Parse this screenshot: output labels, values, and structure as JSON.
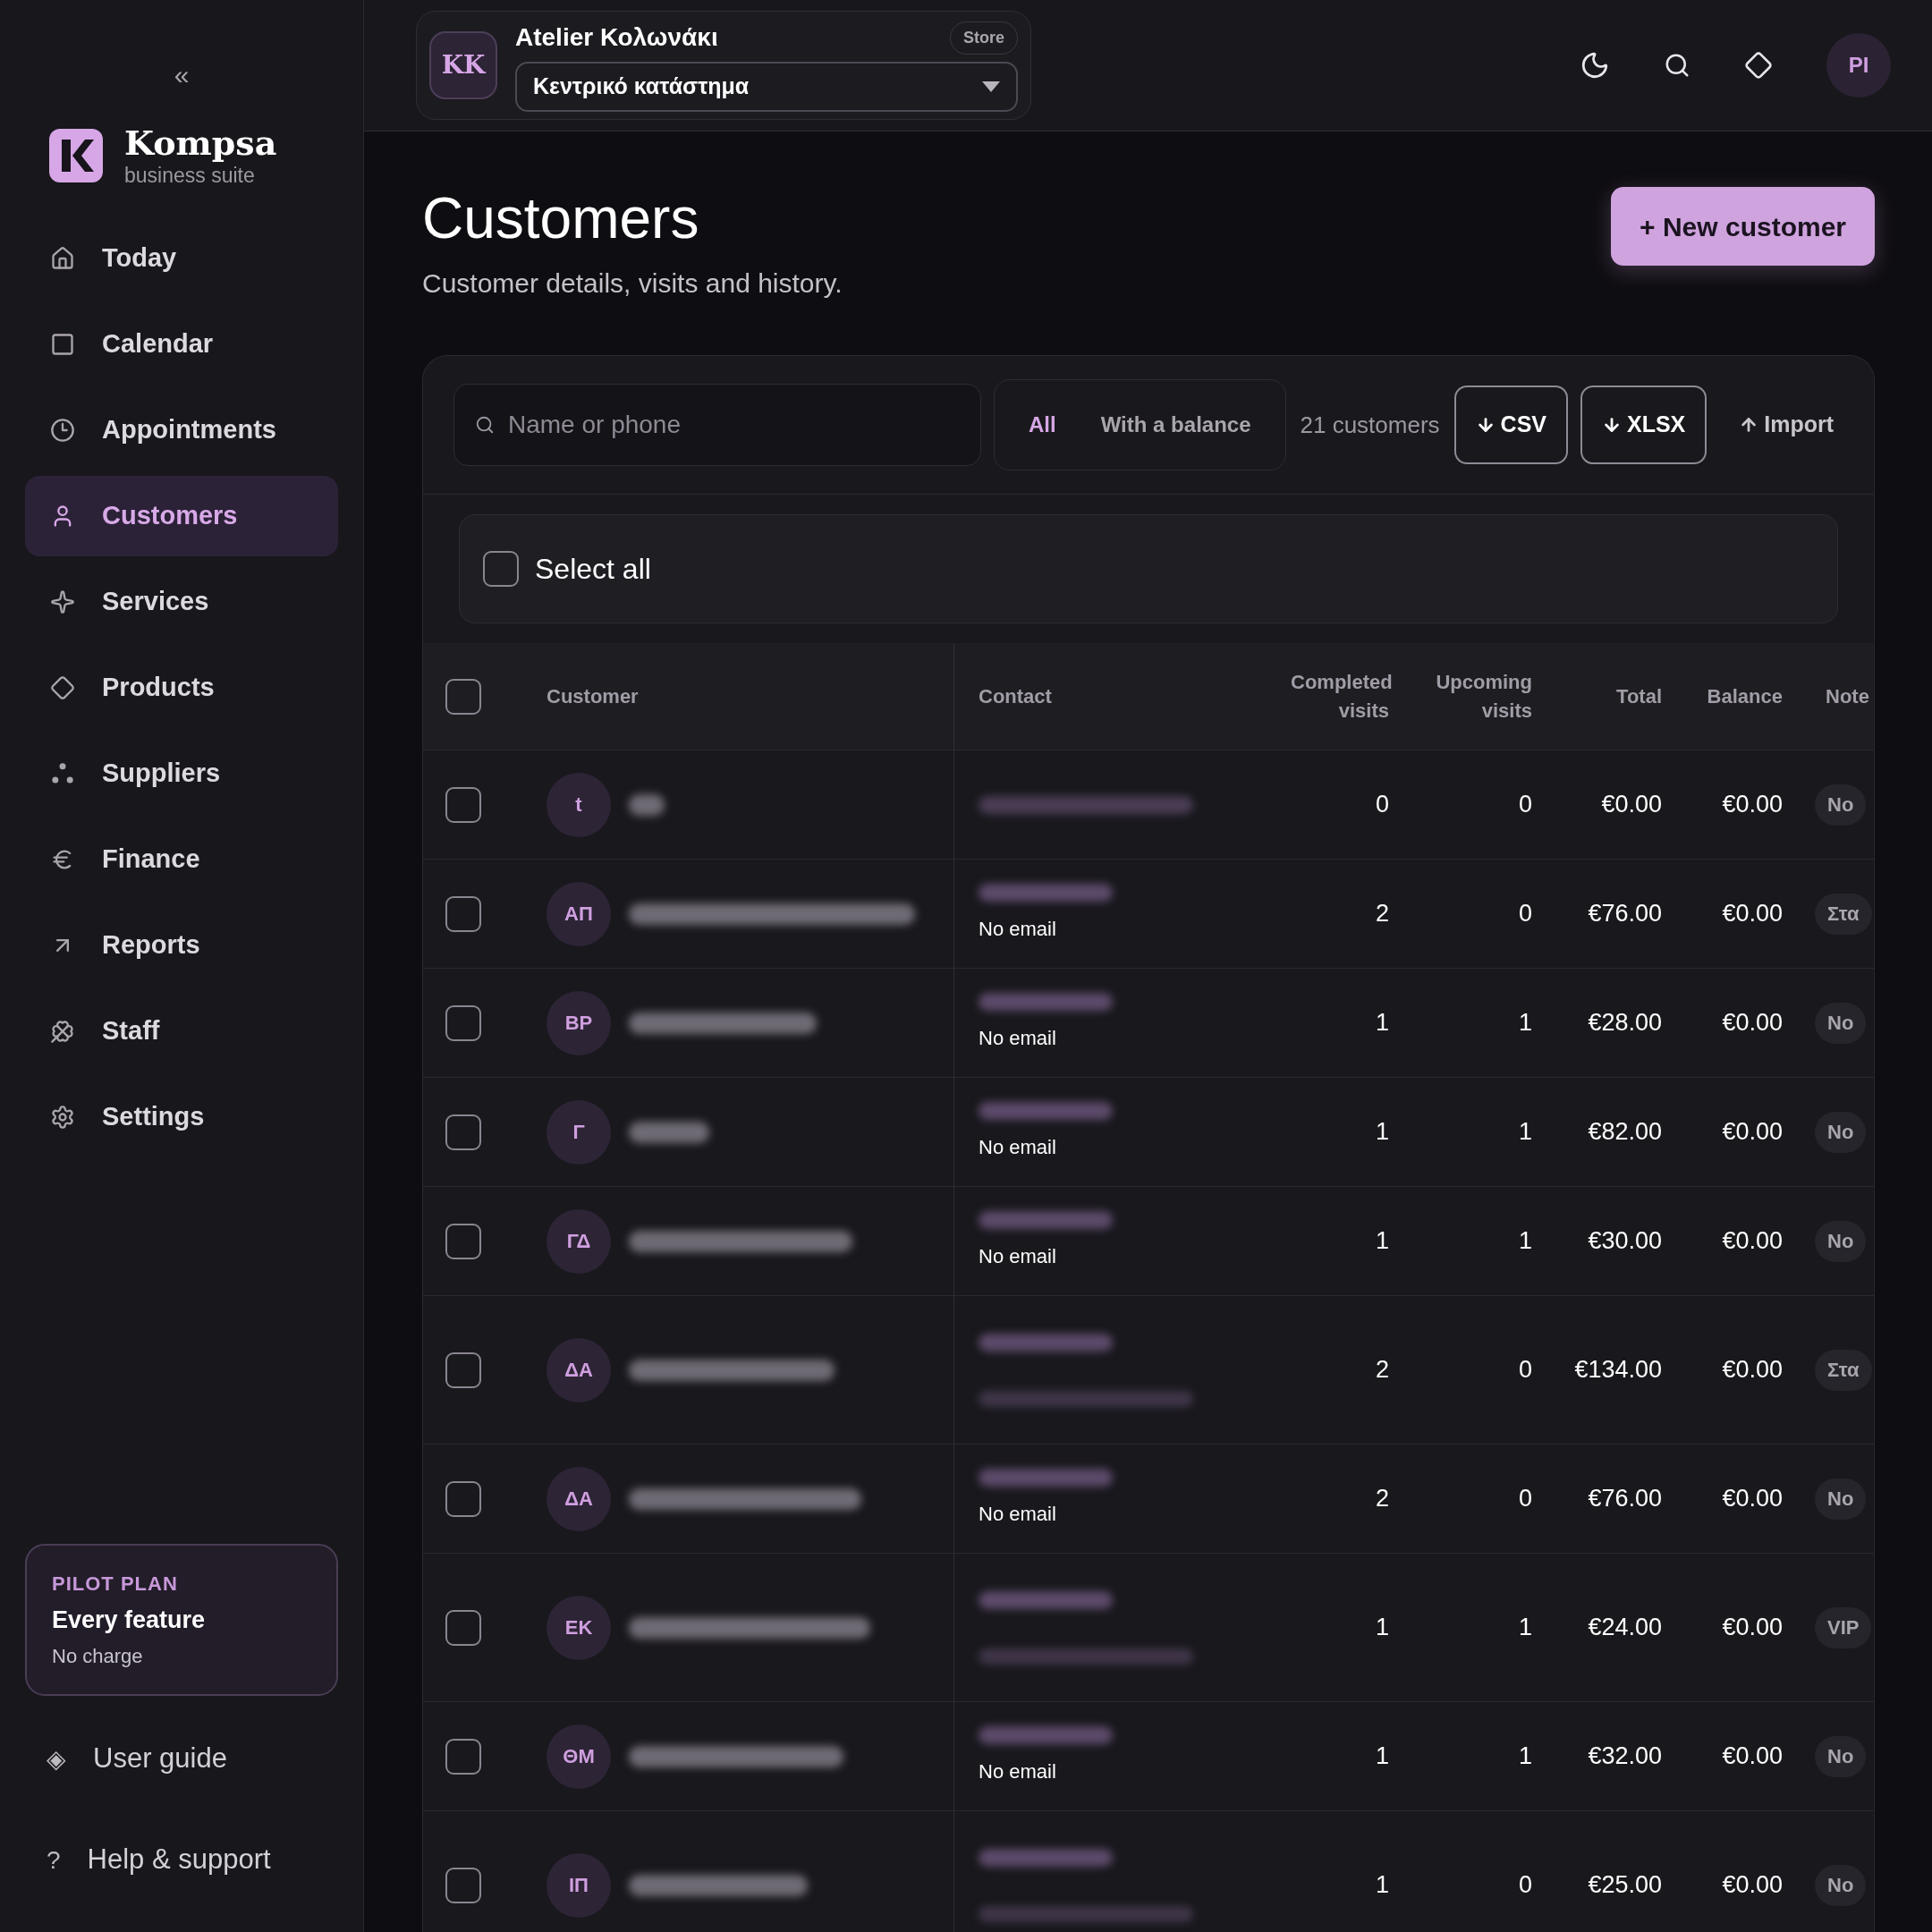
{
  "sidebar": {
    "collapse": "«",
    "brand": {
      "name": "Kompsa",
      "tagline": "business suite"
    },
    "items": [
      {
        "label": "Today",
        "selected": false
      },
      {
        "label": "Calendar",
        "selected": false
      },
      {
        "label": "Appointments",
        "selected": false
      },
      {
        "label": "Customers",
        "selected": true
      },
      {
        "label": "Services",
        "selected": false
      },
      {
        "label": "Products",
        "selected": false
      },
      {
        "label": "Suppliers",
        "selected": false
      },
      {
        "label": "Finance",
        "selected": false
      },
      {
        "label": "Reports",
        "selected": false
      },
      {
        "label": "Staff",
        "selected": false
      },
      {
        "label": "Settings",
        "selected": false
      }
    ],
    "plan": {
      "eyebrow": "PILOT PLAN",
      "title": "Every feature",
      "note": "No charge"
    },
    "footer": [
      {
        "icon_char": "◈",
        "label": "User guide"
      },
      {
        "icon_char": "?",
        "label": "Help & support"
      }
    ]
  },
  "topbar": {
    "store": {
      "initials": "KK",
      "name": "Atelier Κολωνάκι",
      "badge": "Store",
      "location": "Κεντρικό κατάστημα"
    },
    "user_initials": "PI"
  },
  "page": {
    "title": "Customers",
    "subtitle": "Customer details, visits and history.",
    "new_button": "+ New customer"
  },
  "toolbar": {
    "search": {
      "placeholder": "Name or phone"
    },
    "filters": [
      {
        "label": "All",
        "selected": true
      },
      {
        "label": "With a balance",
        "selected": false
      }
    ],
    "count": "21 customers",
    "actions": [
      {
        "label": "CSV",
        "kind": "download"
      },
      {
        "label": "XLSX",
        "kind": "download"
      },
      {
        "label": "Import",
        "kind": "import"
      }
    ]
  },
  "select_all": {
    "label": "Select all",
    "checked": false
  },
  "table": {
    "header_checked": false,
    "columns": [
      "Customer",
      "Contact",
      "Completed visits",
      "Upcoming visits",
      "Total",
      "Balance",
      "Note"
    ],
    "rows": [
      {
        "checked": false,
        "initials": "t",
        "kind": "single",
        "completed": "0",
        "upcoming": "0",
        "total": "€0.00",
        "balance": "€0.00",
        "note": "No"
      },
      {
        "checked": false,
        "initials": "ΑΠ",
        "kind": "no-email",
        "email": "No email",
        "completed": "2",
        "upcoming": "0",
        "total": "€76.00",
        "balance": "€0.00",
        "note": "Στα"
      },
      {
        "checked": false,
        "initials": "ΒΡ",
        "kind": "no-email",
        "email": "No email",
        "completed": "1",
        "upcoming": "1",
        "total": "€28.00",
        "balance": "€0.00",
        "note": "No"
      },
      {
        "checked": false,
        "initials": "Γ",
        "kind": "no-email",
        "email": "No email",
        "completed": "1",
        "upcoming": "1",
        "total": "€82.00",
        "balance": "€0.00",
        "note": "No"
      },
      {
        "checked": false,
        "initials": "ΓΔ",
        "kind": "no-email",
        "email": "No email",
        "completed": "1",
        "upcoming": "1",
        "total": "€30.00",
        "balance": "€0.00",
        "note": "No"
      },
      {
        "checked": false,
        "initials": "ΔΑ",
        "kind": "both",
        "completed": "2",
        "upcoming": "0",
        "total": "€134.00",
        "balance": "€0.00",
        "note": "Στα"
      },
      {
        "checked": false,
        "initials": "ΔΑ",
        "kind": "no-email",
        "email": "No email",
        "completed": "2",
        "upcoming": "0",
        "total": "€76.00",
        "balance": "€0.00",
        "note": "No"
      },
      {
        "checked": false,
        "initials": "ΕΚ",
        "kind": "both",
        "completed": "1",
        "upcoming": "1",
        "total": "€24.00",
        "balance": "€0.00",
        "note": "VIP"
      },
      {
        "checked": false,
        "initials": "ΘΜ",
        "kind": "no-email",
        "email": "No email",
        "completed": "1",
        "upcoming": "1",
        "total": "€32.00",
        "balance": "€0.00",
        "note": "No"
      },
      {
        "checked": false,
        "initials": "ΙΠ",
        "kind": "both",
        "completed": "1",
        "upcoming": "0",
        "total": "€25.00",
        "balance": "€0.00",
        "note": "No"
      }
    ]
  }
}
